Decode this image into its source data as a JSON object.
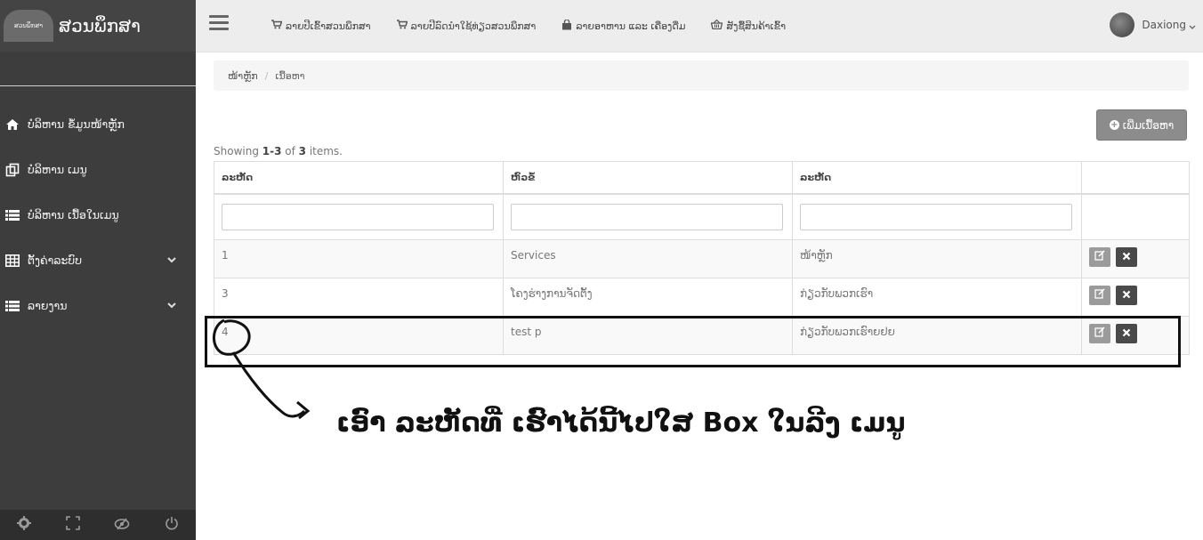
{
  "sidebar": {
    "brand_logo_text": "ສວນພຶກສາ",
    "brand_title": "ສວນພຶກສາ",
    "items": [
      {
        "label": "ບໍລິຫານ ຂໍ້ມູນໜ້າຫຼັກ",
        "icon": "home-icon"
      },
      {
        "label": "ບໍລິຫານ ເມນູ",
        "icon": "copy-icon"
      },
      {
        "label": "ບໍລິຫານ ເນື້ອໃນເມນູ",
        "icon": "list-icon"
      },
      {
        "label": "ຕັ້ງຄ່າລະບົບ",
        "icon": "table-icon"
      },
      {
        "label": "ລາຍງານ",
        "icon": "list-icon"
      }
    ],
    "footer_icons": [
      "gear-icon",
      "fullscreen-icon",
      "eye-slash-icon",
      "power-icon"
    ]
  },
  "topnav": {
    "links": [
      {
        "label": "ລາຍປີເຂົ້າສວນພຶກສາ",
        "icon": "cart-icon"
      },
      {
        "label": "ລາຍປີລົດນຳໃຊ້ທ່ຽວສວນພຶກສາ",
        "icon": "cart-icon"
      },
      {
        "label": "ລາຍອາຫານ ແລະ ເຄື່ອງດື່ມ",
        "icon": "bag-icon"
      },
      {
        "label": "ສັງຊື້ສິນຄ້າເຂົ້າ",
        "icon": "basket-icon"
      }
    ],
    "user_name": "Daxiong"
  },
  "breadcrumb": {
    "home": "ໜ້າຫຼັກ",
    "separator": "/",
    "current": "ເນື້ອຫາ"
  },
  "add_button_label": "ເພີ່ມເນື້ອຫາ",
  "summary": {
    "prefix": "Showing ",
    "range": "1-3",
    "middle": " of ",
    "total": "3",
    "suffix": " items."
  },
  "table": {
    "columns": [
      "ລະຫັດ",
      "ຫົວຂໍ້",
      "ລະຫັດ",
      ""
    ],
    "rows": [
      {
        "id": "1",
        "title": "Services",
        "menu": "ໜ້າຫຼັກ"
      },
      {
        "id": "3",
        "title": "ໂຄງຮ່າງການຈັດຕັ້ງ",
        "menu": "ກ່ຽວກັບພວກເຮົາ"
      },
      {
        "id": "4",
        "title": "test p",
        "menu": "ກ່ຽວກັບພວກເຮົາຍຢຍ"
      }
    ]
  },
  "annotation": {
    "text": "ເອົາ ລະຫັດທີ່ ເຮົາໄດ້ນີ້ໄປໃສ Box ໃນລີງ ເມນູ"
  }
}
